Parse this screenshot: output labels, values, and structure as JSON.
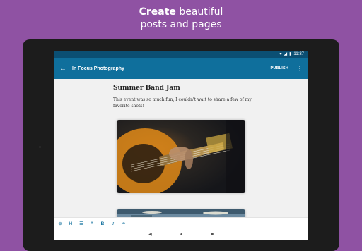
{
  "promo": {
    "line1_bold": "Create",
    "line1_rest": " beautiful",
    "line2": "posts and pages"
  },
  "status_bar": {
    "time": "11:37",
    "icons": [
      "wifi-icon",
      "signal-icon",
      "battery-icon"
    ]
  },
  "app_bar": {
    "back_icon": "arrow-back-icon",
    "site_title": "In Focus Photography",
    "publish_label": "PUBLISH",
    "more_icon": "more-vert-icon"
  },
  "post": {
    "title": "Summer Band Jam",
    "body": "This event was so much fun, I couldn't wait to share a few of my favorite shots!",
    "images": [
      "guitar-photo",
      "drum-photo"
    ]
  },
  "format_toolbar": {
    "items": [
      {
        "name": "add-block-icon",
        "glyph": "⊕"
      },
      {
        "name": "heading-button",
        "glyph": "H"
      },
      {
        "name": "list-button",
        "glyph": "☰"
      },
      {
        "name": "quote-button",
        "glyph": "“"
      },
      {
        "name": "bold-button",
        "glyph": "B"
      },
      {
        "name": "italic-button",
        "glyph": "I"
      },
      {
        "name": "link-button",
        "glyph": "⚭"
      }
    ]
  },
  "nav_bar": {
    "back": "◀",
    "home": "●",
    "recents": "■"
  },
  "colors": {
    "background": "#8f52a3",
    "app_bar": "#0f6f9c",
    "status_bar": "#0b4f73",
    "editor_bg": "#f1f1f1"
  }
}
